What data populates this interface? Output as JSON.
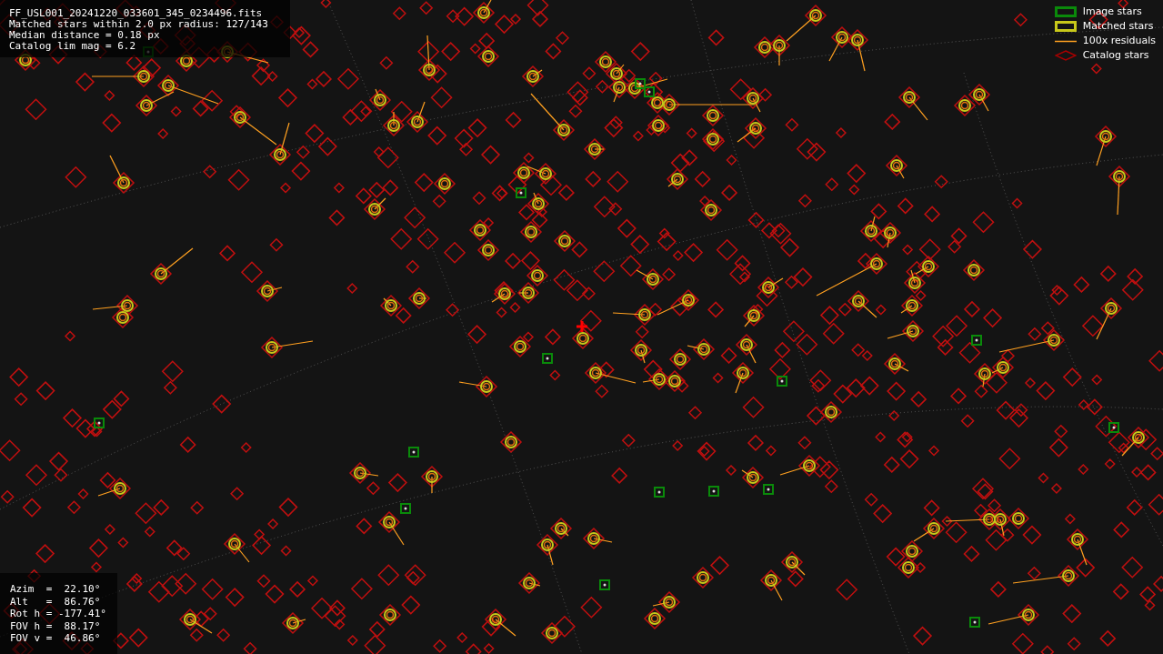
{
  "info_lines": [
    "FF_USL001_20241220_033601_345_0234496.fits",
    "Matched stars within 2.0 px radius: 127/143",
    "Median distance = 0.18 px",
    "Catalog lim mag = 6.2"
  ],
  "legend": [
    {
      "kind": "image",
      "label": "Image stars"
    },
    {
      "kind": "matched",
      "label": "Matched stars"
    },
    {
      "kind": "residual",
      "label": "100x residuals"
    },
    {
      "kind": "catalog",
      "label": "Catalog stars"
    }
  ],
  "pointing": [
    "Azim  =  22.10°",
    "Alt   =  86.76°",
    "Rot h = -177.41°",
    "FOV h =  88.17°",
    "FOV v =  46.86°"
  ]
}
